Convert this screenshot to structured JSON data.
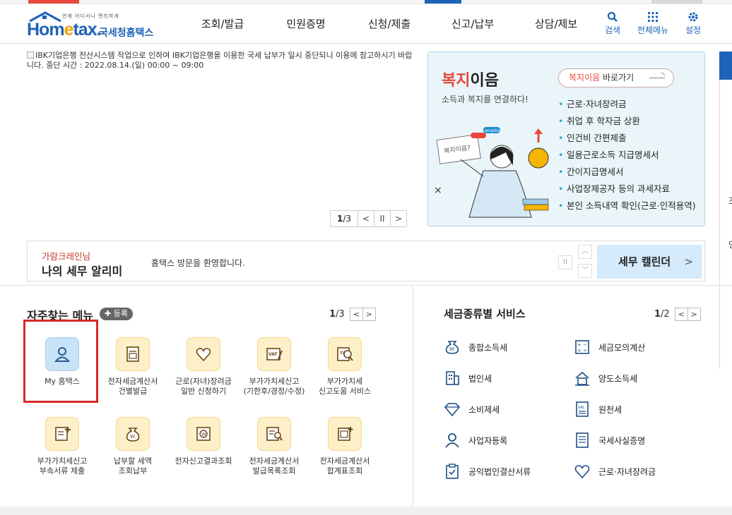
{
  "header": {
    "logo_sub": "언제 어디서나 편리하게",
    "logo_main_1": "Hom",
    "logo_main_2": "e",
    "logo_main_3": "tax.",
    "logo_kr": "국세청홈택스",
    "nav": [
      "조회/발급",
      "민원증명",
      "신청/제출",
      "신고/납부",
      "상담/제보"
    ],
    "util": [
      {
        "label": "검색",
        "icon": "search-icon"
      },
      {
        "label": "전체메뉴",
        "icon": "grid-icon"
      },
      {
        "label": "설정",
        "icon": "gear-icon"
      }
    ]
  },
  "notice": {
    "text": "IBK기업은행 전산시스템 작업으로 인하여 IBK기업은행을 이용한 국세 납부가 일시 중단되니 이용에 참고하시기 바랍니다. 중단 시간 : 2022.08.14.(일) 00:00 ~ 09:00",
    "pager_current": "1",
    "pager_total": "/3",
    "prev": "<",
    "pause": "II",
    "next": ">"
  },
  "welfare": {
    "title_accent": "복지",
    "title_rest": "이음",
    "subtitle": "소득과 복지를 연결하다!",
    "go_accent": "복지이음",
    "go_rest": " 바로가기",
    "items": [
      "근로·자녀장려금",
      "취업 후 학자금 상환",
      "인건비 간편제출",
      "일용근로소득 지급명세서",
      "간이지급명세서",
      "사업장제공자 등의 과세자료",
      "본인 소득내역 확인(근로·인적용역)"
    ],
    "illus_bubble": "복지이음?",
    "illus_tag": "employ"
  },
  "alarm": {
    "name": "가람크레인님",
    "title": "나의 세무 알리미",
    "message": "홈택스 방문을 환영합니다.",
    "pause": "II",
    "up": "︿",
    "down": "﹀",
    "calendar": "세무 캘린더",
    "calendar_chev": ">"
  },
  "favorites": {
    "title": "자주찾는 메뉴",
    "add": "✚ 등록",
    "page_current": "1",
    "page_total": "/3",
    "prev": "<",
    "next": ">",
    "tiles": [
      {
        "label": "My 홈택스",
        "icon": "user-icon"
      },
      {
        "label": "전자세금계산서\n건별발급",
        "icon": "invoice-icon"
      },
      {
        "label": "근로(자녀)장려금\n일반 신청하기",
        "icon": "heart-icon"
      },
      {
        "label": "부가가치세신고\n(기한후/경정/수정)",
        "icon": "vat-icon"
      },
      {
        "label": "부가가치세\n신고도움 서비스",
        "icon": "won-search-icon"
      },
      {
        "label": "부가가치세신고\n부속서류 제출",
        "icon": "doc-plus-icon"
      },
      {
        "label": "납부할 세액\n조회납부",
        "icon": "money-bag-icon"
      },
      {
        "label": "전자신고결과조회",
        "icon": "won-doc-icon"
      },
      {
        "label": "전자세금계산서\n발급목록조회",
        "icon": "list-search-icon"
      },
      {
        "label": "전자세금계산서\n합계표조회",
        "icon": "sum-doc-icon"
      }
    ]
  },
  "tax_services": {
    "title": "세금종류별 서비스",
    "page_current": "1",
    "page_total": "/2",
    "prev": "<",
    "next": ">",
    "items": [
      {
        "label": "종합소득세",
        "icon": "money-bag-icon"
      },
      {
        "label": "세금모의계산",
        "icon": "calculator-icon"
      },
      {
        "label": "법인세",
        "icon": "building-icon"
      },
      {
        "label": "양도소득세",
        "icon": "transfer-icon"
      },
      {
        "label": "소비제세",
        "icon": "diamond-icon"
      },
      {
        "label": "원천세",
        "icon": "salary-doc-icon"
      },
      {
        "label": "사업자등록",
        "icon": "person-icon"
      },
      {
        "label": "국세사실증명",
        "icon": "certificate-icon"
      },
      {
        "label": "공익법인결산서류",
        "icon": "clipboard-icon"
      },
      {
        "label": "근로·자녀장려금",
        "icon": "heart-icon"
      }
    ]
  },
  "right_panel": [
    "조",
    "인"
  ],
  "colors": {
    "brand": "#1f63b8",
    "accent": "#e8473b",
    "tile_bg": "#fdf0c8",
    "highlight": "#d62a2a"
  }
}
